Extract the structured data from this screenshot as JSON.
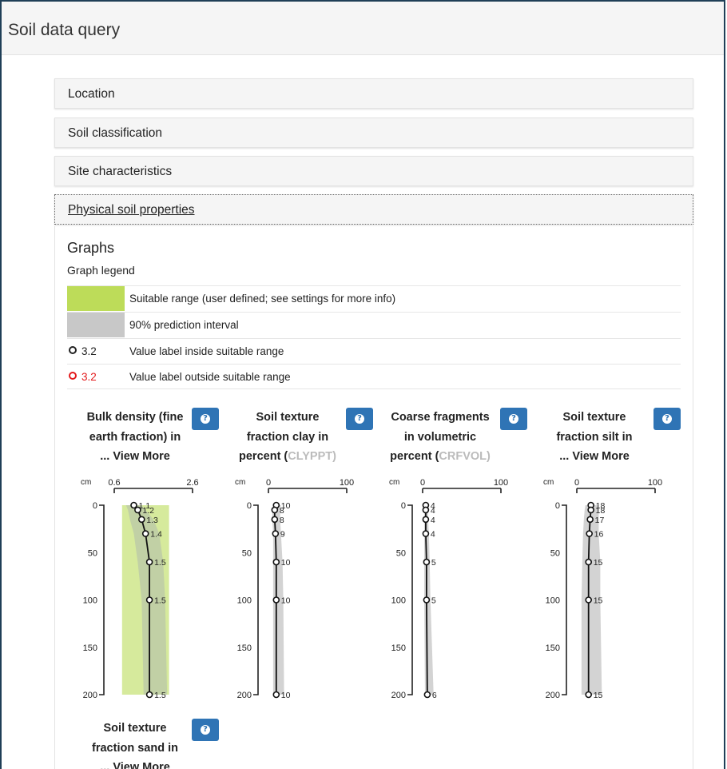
{
  "window": {
    "title": "Soil data query"
  },
  "panels": [
    {
      "label": "Location"
    },
    {
      "label": "Soil classification"
    },
    {
      "label": "Site characteristics"
    },
    {
      "label": "Physical soil properties"
    }
  ],
  "graphs": {
    "heading": "Graphs",
    "legend_heading": "Graph legend",
    "legend": [
      {
        "kind": "swatch",
        "color": "#bddc59",
        "label": "Suitable range (user defined; see settings for more info)"
      },
      {
        "kind": "swatch",
        "color": "#c8c8c8",
        "label": "90% prediction interval"
      },
      {
        "kind": "marker",
        "value": "3.2",
        "color": "#222222",
        "label": "Value label inside suitable range"
      },
      {
        "kind": "marker",
        "value": "3.2",
        "color": "#e31a1c",
        "label": "Value label outside suitable range"
      }
    ]
  },
  "chart_titles": [
    {
      "line1": "Bulk density (fine",
      "line2": "earth fraction) in",
      "line3": "... View More",
      "line3_code": ""
    },
    {
      "line1": "Soil texture",
      "line2": "fraction clay in",
      "line3": "percent (",
      "line3_code": "CLYPPT)"
    },
    {
      "line1": "Coarse fragments",
      "line2": "in volumetric",
      "line3": "percent (",
      "line3_code": "CRFVOL)"
    },
    {
      "line1": "Soil texture",
      "line2": "fraction silt in",
      "line3": "... View More",
      "line3_code": ""
    }
  ],
  "chart5_title": {
    "line1": "Soil texture",
    "line2": "fraction sand in",
    "line3": "... View More"
  },
  "chart_data": [
    {
      "type": "line",
      "title": "Bulk density (fine earth fraction) in ... View More",
      "x_unit_label": "cm",
      "xlim": [
        0.6,
        2.6
      ],
      "x_ticks": [
        "0.6",
        "2.6"
      ],
      "ylim": [
        0,
        200
      ],
      "y_ticks": [
        "0",
        "50",
        "100",
        "150",
        "200"
      ],
      "depth": [
        0,
        5,
        15,
        30,
        60,
        100,
        200
      ],
      "values": [
        1.1,
        1.2,
        1.3,
        1.4,
        1.5,
        1.5,
        1.5
      ],
      "pi_low": [
        0.9,
        0.95,
        1.0,
        1.1,
        1.2,
        1.3,
        1.35
      ],
      "pi_high": [
        1.3,
        1.4,
        1.6,
        1.75,
        1.85,
        1.9,
        1.95
      ],
      "suitable_range": [
        0.8,
        2.0
      ]
    },
    {
      "type": "line",
      "title": "Soil texture fraction clay in percent (CLYPPT)",
      "x_unit_label": "cm",
      "xlim": [
        0,
        100
      ],
      "x_ticks": [
        "0",
        "100"
      ],
      "ylim": [
        0,
        200
      ],
      "y_ticks": [
        "0",
        "50",
        "100",
        "150",
        "200"
      ],
      "depth": [
        0,
        5,
        15,
        30,
        60,
        100,
        200
      ],
      "values": [
        10,
        8,
        8,
        9,
        10,
        10,
        10
      ],
      "pi_low": [
        6,
        5,
        5,
        6,
        6,
        6,
        6
      ],
      "pi_high": [
        16,
        15,
        15,
        16,
        18,
        19,
        20
      ],
      "suitable_range": null
    },
    {
      "type": "line",
      "title": "Coarse fragments in volumetric percent (CRFVOL)",
      "x_unit_label": "cm",
      "xlim": [
        0,
        100
      ],
      "x_ticks": [
        "0",
        "100"
      ],
      "ylim": [
        0,
        200
      ],
      "y_ticks": [
        "0",
        "50",
        "100",
        "150",
        "200"
      ],
      "depth": [
        0,
        5,
        15,
        30,
        60,
        100,
        200
      ],
      "values": [
        4,
        4,
        4,
        4,
        5,
        5,
        6
      ],
      "pi_low": [
        2,
        2,
        2,
        2,
        2,
        2,
        3
      ],
      "pi_high": [
        7,
        7,
        7,
        8,
        9,
        10,
        14
      ],
      "suitable_range": null
    },
    {
      "type": "line",
      "title": "Soil texture fraction silt in ... View More",
      "x_unit_label": "cm",
      "xlim": [
        0,
        100
      ],
      "x_ticks": [
        "0",
        "100"
      ],
      "ylim": [
        0,
        200
      ],
      "y_ticks": [
        "0",
        "50",
        "100",
        "150",
        "200"
      ],
      "depth": [
        0,
        5,
        15,
        30,
        60,
        100,
        200
      ],
      "values": [
        18,
        18,
        17,
        16,
        15,
        15,
        15
      ],
      "pi_low": [
        11,
        10,
        9,
        8,
        7,
        6,
        6
      ],
      "pi_high": [
        28,
        28,
        28,
        28,
        30,
        30,
        32
      ],
      "suitable_range": null
    }
  ]
}
